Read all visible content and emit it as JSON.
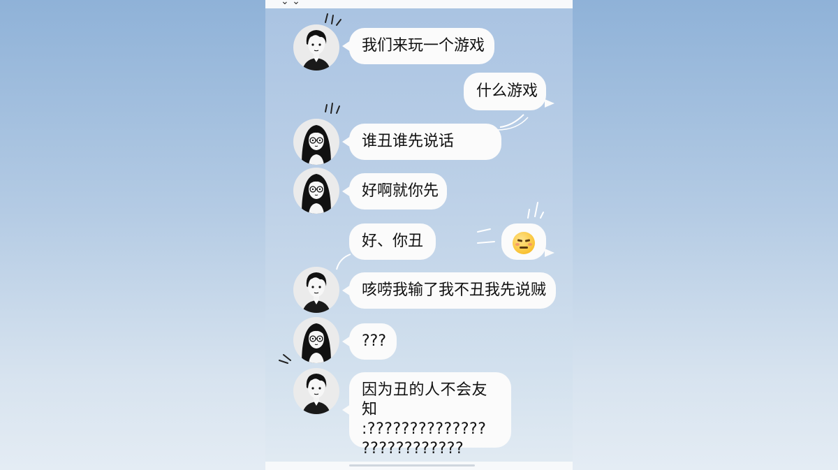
{
  "chat": {
    "messages": [
      {
        "sender": "boy",
        "text": "我们来玩一个游戏"
      },
      {
        "sender": "self",
        "text": "什么游戏"
      },
      {
        "sender": "girl",
        "text": "谁丑谁先说话"
      },
      {
        "sender": "girl",
        "text": "好啊就你先"
      },
      {
        "sender": "self",
        "text": "好、你丑"
      },
      {
        "sender": "self",
        "emoji": "annoyed-face-emoji"
      },
      {
        "sender": "boy",
        "text": "咳唠我输了我不丑我先说贼"
      },
      {
        "sender": "girl",
        "text": "???"
      },
      {
        "sender": "boy",
        "lines": [
          "因为丑的人不会友知",
          ":??????????????",
          "????????????"
        ]
      }
    ]
  },
  "icons": {
    "boy_avatar": "boy-avatar-icon",
    "girl_avatar": "girl-glasses-avatar-icon"
  },
  "colors": {
    "background_top": "#8fb2d8",
    "background_bottom": "#e4ecf4",
    "bubble": "#fbfbfb",
    "text": "#111111"
  }
}
